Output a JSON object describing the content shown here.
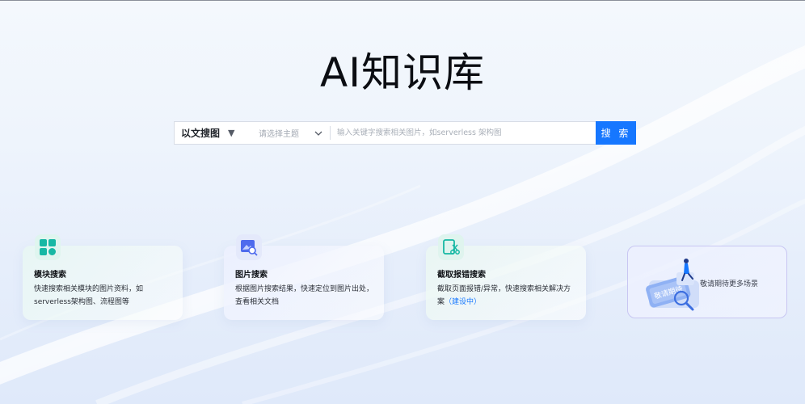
{
  "page": {
    "title": "AI知识库"
  },
  "search": {
    "mode_label": "以文搜图",
    "topic_placeholder": "请选择主题",
    "input_placeholder": "输入关键字搜索相关图片，如serverless 架构图",
    "button_label": "搜 索"
  },
  "cards": [
    {
      "title": "模块搜索",
      "desc": "快速搜索相关模块的图片资料，如serverless架构图、流程图等",
      "icon": "grid-modules-icon"
    },
    {
      "title": "图片搜索",
      "desc": "根据图片搜索结果，快速定位到图片出处，查看相关文档",
      "icon": "image-search-icon"
    },
    {
      "title": "截取报错搜索",
      "desc": "截取页面报错/异常，快速搜索相关解决方案",
      "tag": "（建设中）",
      "icon": "screenshot-cut-icon"
    }
  ],
  "more": {
    "text": "敬请期待更多场景",
    "badge_text": "敬请期待",
    "illustration": "invitation-card-illustration"
  },
  "colors": {
    "primary": "#1677ff",
    "teal": "#16b8a4",
    "title": "#0b0d12"
  }
}
